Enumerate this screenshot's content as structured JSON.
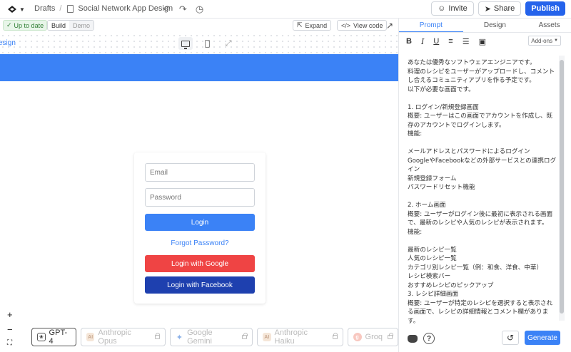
{
  "header": {
    "breadcrumb_root": "Drafts",
    "separator": "/",
    "project_title": "Social Network App Design",
    "invite_label": "Invite",
    "share_label": "Share",
    "publish_label": "Publish"
  },
  "toolbar": {
    "status": "Up to date",
    "mode_build": "Build",
    "mode_demo": "Demo",
    "expand_label": "Expand",
    "view_code_label": "View code"
  },
  "canvas": {
    "partial_label": "esign",
    "login": {
      "email_placeholder": "Email",
      "password_placeholder": "Password",
      "login_label": "Login",
      "forgot_label": "Forgot Password?",
      "google_label": "Login with Google",
      "facebook_label": "Login with Facebook"
    }
  },
  "zoom": {
    "in": "+",
    "out": "−",
    "fit": "⛶"
  },
  "models": [
    {
      "label": "GPT-4",
      "active": true
    },
    {
      "label": "Anthropic Opus",
      "active": false
    },
    {
      "label": "Google Gemini",
      "active": false
    },
    {
      "label": "Anthropic Haiku",
      "active": false
    },
    {
      "label": "Groq",
      "active": false
    }
  ],
  "panel": {
    "tabs": [
      "Prompt",
      "Design",
      "Assets"
    ],
    "addons_label": "Add-ons",
    "generate_label": "Generate",
    "help": "?",
    "prompt_lines": [
      "あなたは優秀なソフトウェアエンジニアです。",
      "料理のレシピをユーザーがアップロードし、コメントし合えるコミュニティアプリを作る予定です。",
      "以下が必要な画面です。",
      "",
      "1. ログイン/新規登録画面",
      "概要: ユーザーはこの画面でアカウントを作成し、既存のアカウントでログインします。",
      "機能:",
      "",
      "メールアドレスとパスワードによるログイン",
      "GoogleやFacebookなどの外部サービスとの連携ログイン",
      "新規登録フォーム",
      "パスワードリセット機能",
      "",
      "2. ホーム画面",
      "概要: ユーザーがログイン後に最初に表示される画面で、最新のレシピや人気のレシピが表示されます。",
      "機能:",
      "",
      "最新のレシピ一覧",
      "人気のレシピ一覧",
      "カテゴリ別レシピ一覧（例：和食、洋食、中華）",
      "レシピ検索バー",
      "おすすめレシピのピックアップ",
      "3. レシピ詳細画面",
      "概要: ユーザーが特定のレシピを選択すると表示される画面で、レシピの詳細情報とコメント欄があります。"
    ]
  },
  "colors": {
    "accent": "#3b82f6",
    "google_btn": "#ef4444",
    "facebook_btn": "#1e40af",
    "status_green": "#2e7d32"
  }
}
